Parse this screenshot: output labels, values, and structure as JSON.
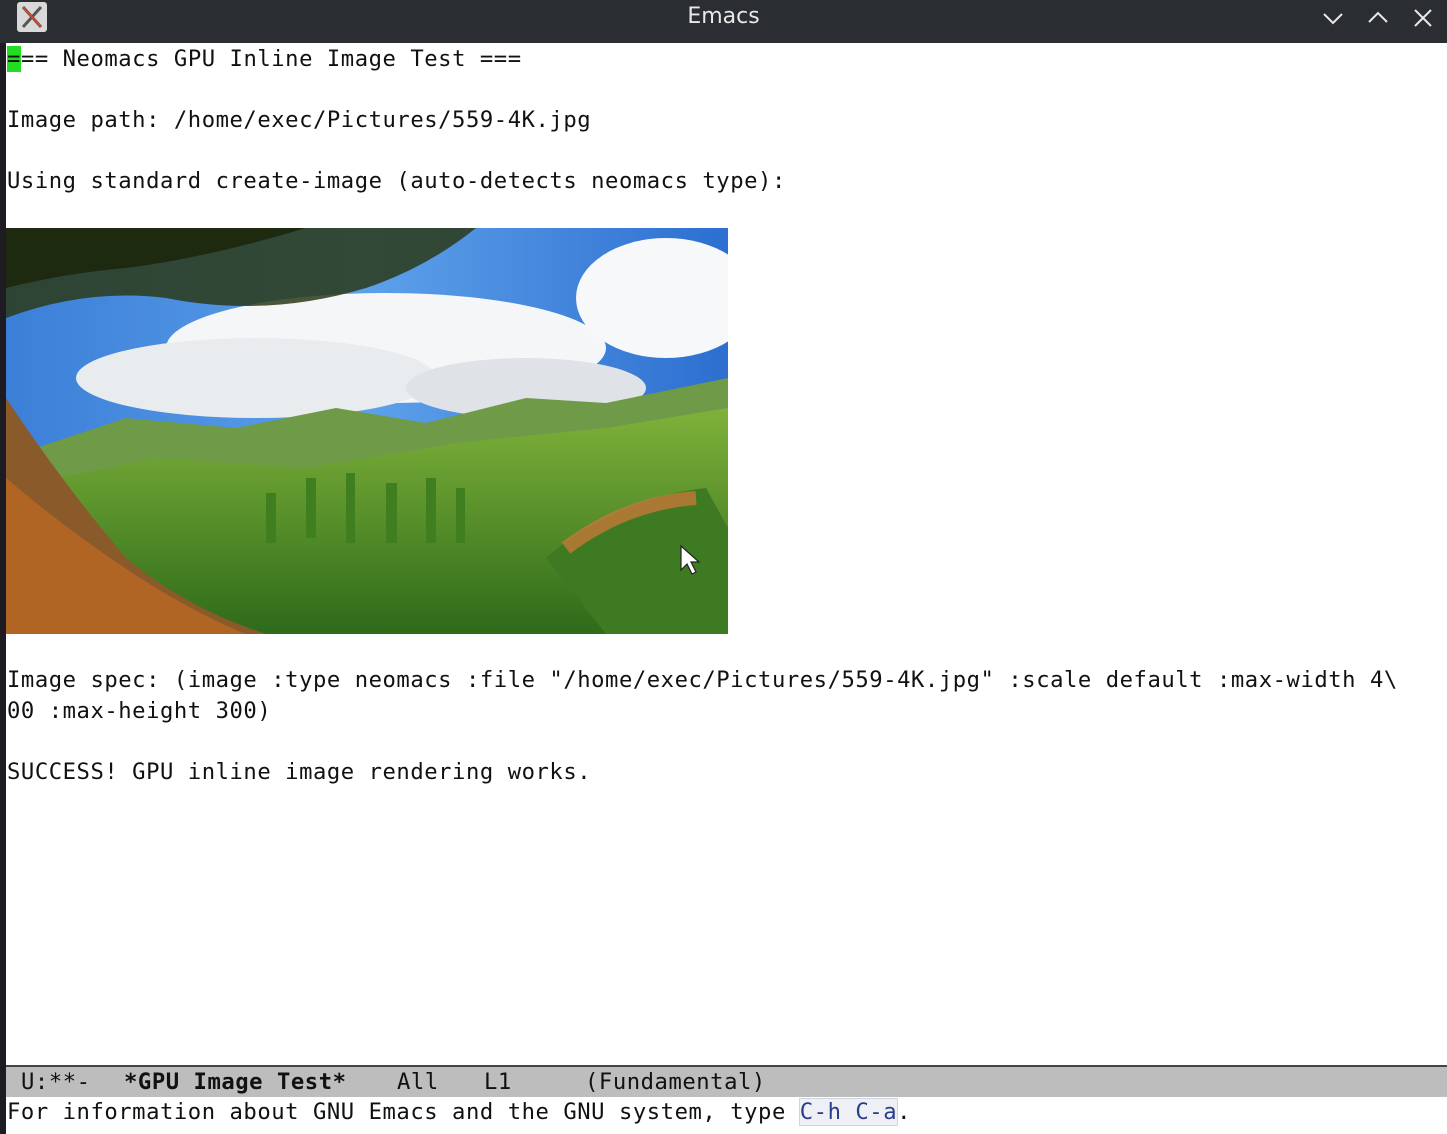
{
  "window": {
    "title": "Emacs",
    "controls": [
      "minimize",
      "maximize",
      "close"
    ]
  },
  "buffer": {
    "cursor_char": "=",
    "heading_rest": "== Neomacs GPU Inline Image Test ===",
    "image_path_line": "Image path: /home/exec/Pictures/559-4K.jpg",
    "using_line": "Using standard create-image (auto-detects neomacs type):",
    "image_description": "Inline landscape photo: green mountain valley under blue sky with clouds",
    "spec_line_1": "Image spec: (image :type neomacs :file \"/home/exec/Pictures/559-4K.jpg\" :scale default :max-width 4\\",
    "spec_line_2": "00 :max-height 300)",
    "success_line": "SUCCESS! GPU inline image rendering works."
  },
  "modeline": {
    "status": "U:**-",
    "buffer_name": "*GPU Image Test*",
    "position": "All",
    "line": "L1",
    "mode": "(Fundamental)"
  },
  "minibuffer": {
    "text_before": "For information about GNU Emacs and the GNU system, type ",
    "key": "C-h C-a",
    "text_after": "."
  },
  "colors": {
    "titlebar": "#2a2d31",
    "cursor": "#22dd22",
    "modeline_bg": "#bdbdbd",
    "key_hint": "#2a3c8c"
  },
  "icons": [
    "app-x-icon",
    "chevron-down-icon",
    "chevron-up-icon",
    "close-icon",
    "mouse-pointer-icon"
  ]
}
